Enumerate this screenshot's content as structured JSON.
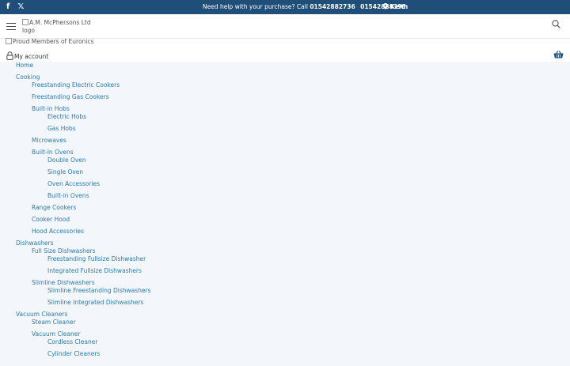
{
  "topbar": {
    "help_text": "Need help with your purchase? Call",
    "phone1": "01542882736",
    "phone2": "01542888396",
    "location": "Keith",
    "social": [
      {
        "icon": "facebook-icon",
        "glyph": "f"
      },
      {
        "icon": "x-twitter-icon",
        "glyph": "𝕏"
      }
    ],
    "bg_color": "#1f4e79"
  },
  "header": {
    "logo_alt": "A.M. McPhersons Ltd logo",
    "members_alt": "Proud Members of Euronics",
    "account_label": "My account"
  },
  "menu": {
    "link_color": "#2a7ab0",
    "items": [
      {
        "label": "Home",
        "level": 0
      },
      {
        "label": "Cooking",
        "level": 0
      },
      {
        "label": "Freestanding Electric Cookers",
        "level": 1
      },
      {
        "label": "Freestanding Gas Cookers",
        "level": 1
      },
      {
        "label": "Built-in Hobs",
        "level": 1
      },
      {
        "label": "Electric Hobs",
        "level": 2
      },
      {
        "label": "Gas Hobs",
        "level": 2
      },
      {
        "label": "Microwaves",
        "level": 1
      },
      {
        "label": "Built-In Ovens",
        "level": 1
      },
      {
        "label": "Double Oven",
        "level": 2
      },
      {
        "label": "Single Oven",
        "level": 2
      },
      {
        "label": "Oven Accessories",
        "level": 2
      },
      {
        "label": "Built-in Ovens",
        "level": 2
      },
      {
        "label": "Range Cookers",
        "level": 1
      },
      {
        "label": "Cooker Hood",
        "level": 1
      },
      {
        "label": "Hood Accessories",
        "level": 1
      },
      {
        "label": "Dishwashers",
        "level": 0
      },
      {
        "label": "Full Size Dishwashers",
        "level": 1
      },
      {
        "label": "Freestanding Fullsize Dishwasher",
        "level": 2
      },
      {
        "label": "Integrated Fullsize Dishwashers",
        "level": 2
      },
      {
        "label": "Slimline Dishwashers",
        "level": 1
      },
      {
        "label": "Slimline Freestanding Dishwashers",
        "level": 2
      },
      {
        "label": "Slimline Integrated Dishwashers",
        "level": 2
      },
      {
        "label": "Vacuum Cleaners",
        "level": 0
      },
      {
        "label": "Steam Cleaner",
        "level": 1
      },
      {
        "label": "Vacuum Cleaner",
        "level": 1
      },
      {
        "label": "Cordless Cleaner",
        "level": 2
      },
      {
        "label": "Cylinder Cleaners",
        "level": 2
      }
    ]
  }
}
